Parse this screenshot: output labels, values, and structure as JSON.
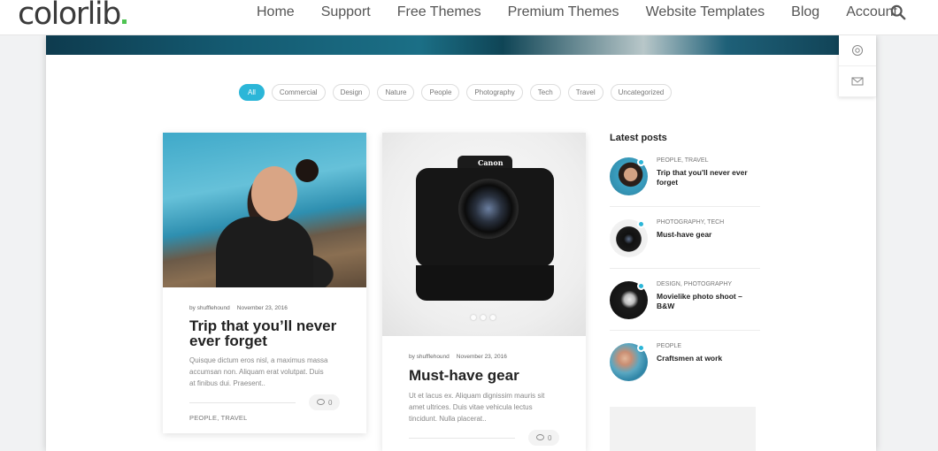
{
  "site": {
    "logo_text": "colorlib",
    "accent_color": "#4fc453"
  },
  "nav": {
    "links": [
      "Home",
      "Support",
      "Free Themes",
      "Premium Themes",
      "Website Templates",
      "Blog",
      "Account"
    ],
    "search_icon": "search-icon"
  },
  "side_tools": {
    "icons": [
      "settings-icon",
      "mail-icon"
    ]
  },
  "filters": {
    "active_color": "#2bb6d8",
    "items": [
      "All",
      "Commercial",
      "Design",
      "Nature",
      "People",
      "Photography",
      "Tech",
      "Travel",
      "Uncategorized"
    ],
    "active": "All"
  },
  "cards": [
    {
      "author": "by shufflehound",
      "date": "November 23, 2016",
      "title_line1": "Trip that you’ll never",
      "title_line2": "ever forget",
      "excerpt_line1": "Quisque dictum eros nisl, a maximus massa",
      "excerpt_line2": "accumsan non. Aliquam erat volutpat. Duis",
      "excerpt_line3": "at finibus dui. Praesent..",
      "comments": "0",
      "categories": "PEOPLE, TRAVEL"
    },
    {
      "author": "by shufflehound",
      "date": "November 23, 2016",
      "title": "Must-have gear",
      "excerpt_line1": "Ut et lacus ex. Aliquam dignissim mauris sit",
      "excerpt_line2": "amet ultrices. Duis vitae vehicula lectus",
      "excerpt_line3": "tincidunt. Nulla placerat..",
      "comments": "0",
      "camera_brand": "Canon"
    }
  ],
  "sidebar": {
    "title": "Latest posts",
    "posts": [
      {
        "categories": "PEOPLE, TRAVEL",
        "title": "Trip that you'll never ever forget"
      },
      {
        "categories": "PHOTOGRAPHY, TECH",
        "title": "Must-have gear"
      },
      {
        "categories": "DESIGN, PHOTOGRAPHY",
        "title": "Movielike photo shoot – B&W"
      },
      {
        "categories": "PEOPLE",
        "title": "Craftsmen at work"
      }
    ]
  }
}
